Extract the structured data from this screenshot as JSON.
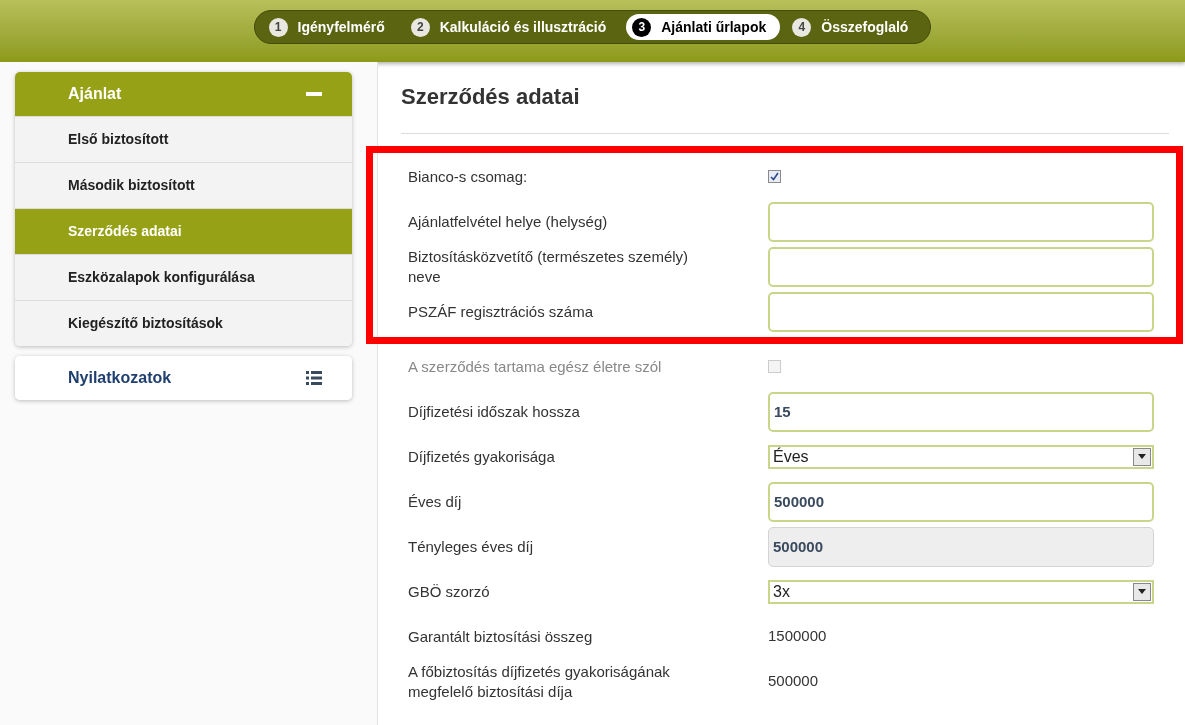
{
  "steps": [
    {
      "number": "1",
      "label": "Igényfelmérő",
      "selected": false
    },
    {
      "number": "2",
      "label": "Kalkuláció és illusztráció",
      "selected": false
    },
    {
      "number": "3",
      "label": "Ajánlati űrlapok",
      "selected": true
    },
    {
      "number": "4",
      "label": "Összefoglaló",
      "selected": false
    }
  ],
  "sidebar": {
    "sections": [
      {
        "title": "Ajánlat",
        "expanded": true,
        "items": [
          {
            "label": "Első biztosított",
            "selected": false
          },
          {
            "label": "Második biztosított",
            "selected": false
          },
          {
            "label": "Szerződés adatai",
            "selected": true
          },
          {
            "label": "Eszközalapok konfigurálása",
            "selected": false
          },
          {
            "label": "Kiegészítő biztosítások",
            "selected": false
          }
        ]
      },
      {
        "title": "Nyilatkozatok",
        "expanded": false
      }
    ]
  },
  "content": {
    "title": "Szerződés adatai",
    "highlighted_fields": [
      {
        "kind": "checkbox",
        "label": "Bianco-s csomag:",
        "checked": true
      },
      {
        "kind": "text",
        "label": "Ajánlatfelvétel helye (helység)"
      },
      {
        "kind": "text",
        "label": "Biztosításközvetítő (természetes személy) neve"
      },
      {
        "kind": "text",
        "label": "PSZÁF regisztrációs száma"
      }
    ],
    "fields": [
      {
        "kind": "checkbox",
        "label": "A szerződés tartama egész életre szól",
        "checked": false,
        "disabled": true
      },
      {
        "kind": "text",
        "label": "Díjfizetési időszak hossza",
        "value": "15"
      },
      {
        "kind": "select",
        "label": "Díjfizetés gyakorisága",
        "value": "Éves"
      },
      {
        "kind": "text",
        "label": "Éves díj",
        "value": "500000"
      },
      {
        "kind": "readonly",
        "label": "Tényleges éves díj",
        "value": "500000"
      },
      {
        "kind": "select",
        "label": "GBÖ szorzó",
        "value": "3x"
      },
      {
        "kind": "static",
        "label": "Garantált biztosítási összeg",
        "value": "1500000"
      },
      {
        "kind": "static",
        "label": "A főbiztosítás díjfizetés gyakoriságának megfelelő biztosítási díja",
        "value": "500000"
      }
    ]
  }
}
